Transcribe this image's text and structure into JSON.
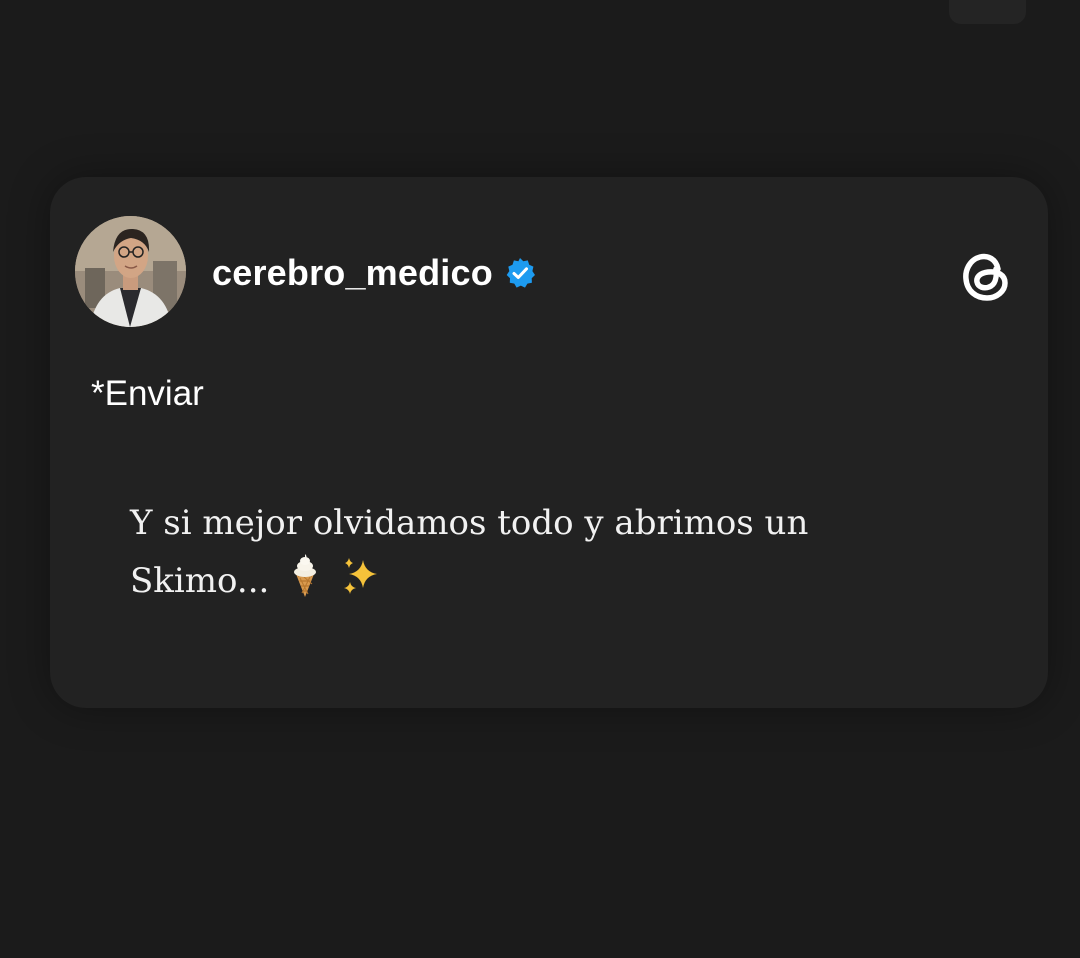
{
  "post": {
    "username": "cerebro_medico",
    "verified": true,
    "caption": "*Enviar",
    "text": "Y si mejor olvidamos todo y abrimos un Skimo...",
    "emojis": [
      "soft-ice-cream-icon",
      "sparkles-icon"
    ]
  },
  "colors": {
    "background": "#1b1b1b",
    "card": "#222222",
    "verified_badge": "#1d9bf0",
    "text": "#ffffff"
  },
  "icons": {
    "app_logo": "threads-logo-icon",
    "badge": "verified-badge-icon"
  }
}
